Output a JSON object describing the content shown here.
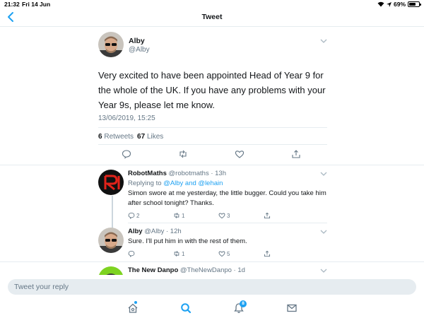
{
  "status_bar": {
    "time": "21:32",
    "date": "Fri 14 Jun",
    "battery": "69%",
    "battery_level": 0.69
  },
  "nav": {
    "title": "Tweet"
  },
  "tweet": {
    "name": "Alby",
    "handle": "@Alby",
    "text": "Very excited to have been appointed Head of Year 9 for the whole of the UK. If you have any problems with your Year 9s, please let me know.",
    "timestamp": "13/06/2019, 15:25",
    "retweets_count": "6",
    "retweets_label": "Retweets",
    "likes_count": "67",
    "likes_label": "Likes"
  },
  "replies": [
    {
      "name": "RobotMaths",
      "handle": "@robotmaths · 13h",
      "replying_prefix": "Replying to",
      "replying_to": "@Alby and @lehain",
      "text": "Simon swore at me yesterday, the little bugger. Could you take him after school tonight? Thanks.",
      "reply_count": "2",
      "retweet_count": "1",
      "like_count": "3"
    },
    {
      "name": "Alby",
      "handle": "@Alby · 12h",
      "text": "Sure. I'll put him in with the rest of them.",
      "reply_count": "",
      "retweet_count": "1",
      "like_count": "5"
    },
    {
      "name": "The New Danpo",
      "handle": "@TheNewDanpo · 1d"
    }
  ],
  "reply_input": {
    "placeholder": "Tweet your reply"
  },
  "tab_bar": {
    "notifications_badge": "8"
  },
  "colors": {
    "accent": "#1da1f2",
    "secondary_text": "#657786",
    "divider": "#e6ecf0",
    "robot_red": "#e2231a",
    "danpo_green": "#7ed321"
  },
  "icons": [
    "back-icon",
    "chevron-down-icon",
    "reply-icon",
    "retweet-icon",
    "like-icon",
    "share-icon",
    "home-icon",
    "search-icon",
    "notifications-icon",
    "messages-icon",
    "wifi-icon",
    "location-icon",
    "battery-icon"
  ]
}
